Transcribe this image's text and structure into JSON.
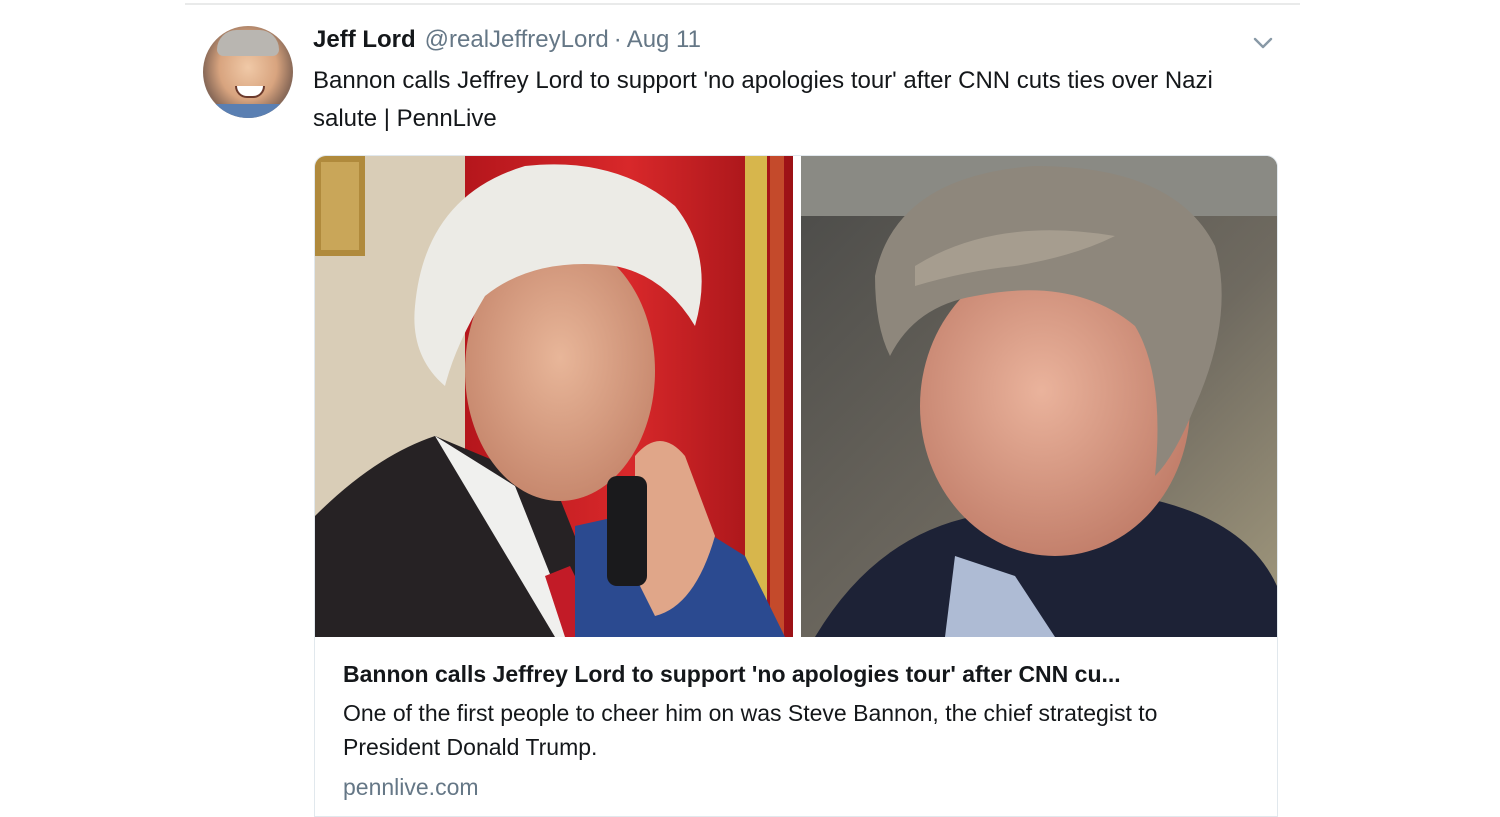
{
  "tweet": {
    "author_name": "Jeff Lord",
    "author_handle": "@realJeffreyLord",
    "separator": "·",
    "date": "Aug 11",
    "text": "Bannon calls Jeffrey Lord to support 'no apologies tour' after CNN cuts ties over Nazi salute | PennLive",
    "menu_icon": "chevron-down-icon",
    "avatar_icon": "avatar"
  },
  "card": {
    "title": "Bannon calls Jeffrey Lord to support 'no apologies tour' after CNN cu...",
    "description": "One of the first people to cheer him on was Steve Bannon, the chief strategist to President Donald Trump.",
    "domain": "pennlive.com"
  },
  "colors": {
    "text": "#14171a",
    "muted": "#657786",
    "border": "#e1e8ed"
  }
}
